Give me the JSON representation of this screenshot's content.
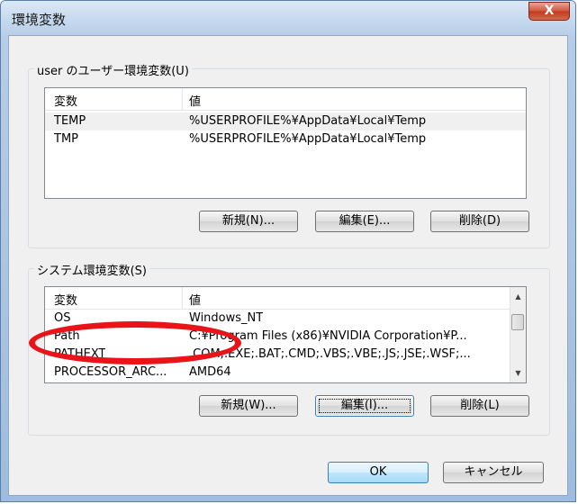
{
  "window": {
    "title": "環境変数",
    "close_label": "X"
  },
  "user_group": {
    "label": "user のユーザー環境変数(U)",
    "columns": [
      "変数",
      "値"
    ],
    "rows": [
      {
        "name": "TEMP",
        "value": "%USERPROFILE%¥AppData¥Local¥Temp"
      },
      {
        "name": "TMP",
        "value": "%USERPROFILE%¥AppData¥Local¥Temp"
      }
    ],
    "buttons": {
      "new": "新規(N)...",
      "edit": "編集(E)...",
      "delete": "削除(D)"
    }
  },
  "system_group": {
    "label": "システム環境変数(S)",
    "columns": [
      "変数",
      "値"
    ],
    "rows": [
      {
        "name": "OS",
        "value": "Windows_NT"
      },
      {
        "name": "Path",
        "value": "C:¥Program Files (x86)¥NVIDIA Corporation¥P..."
      },
      {
        "name": "PATHEXT",
        "value": ".COM;.EXE;.BAT;.CMD;.VBS;.VBE;.JS;.JSE;.WSF;..."
      },
      {
        "name": "PROCESSOR_ARC...",
        "value": "AMD64"
      }
    ],
    "buttons": {
      "new": "新規(W)...",
      "edit": "編集(I)...",
      "delete": "削除(L)"
    }
  },
  "footer": {
    "ok": "OK",
    "cancel": "キャンセル"
  },
  "annotation": {
    "color": "#e8141a",
    "shape": "ellipse"
  }
}
